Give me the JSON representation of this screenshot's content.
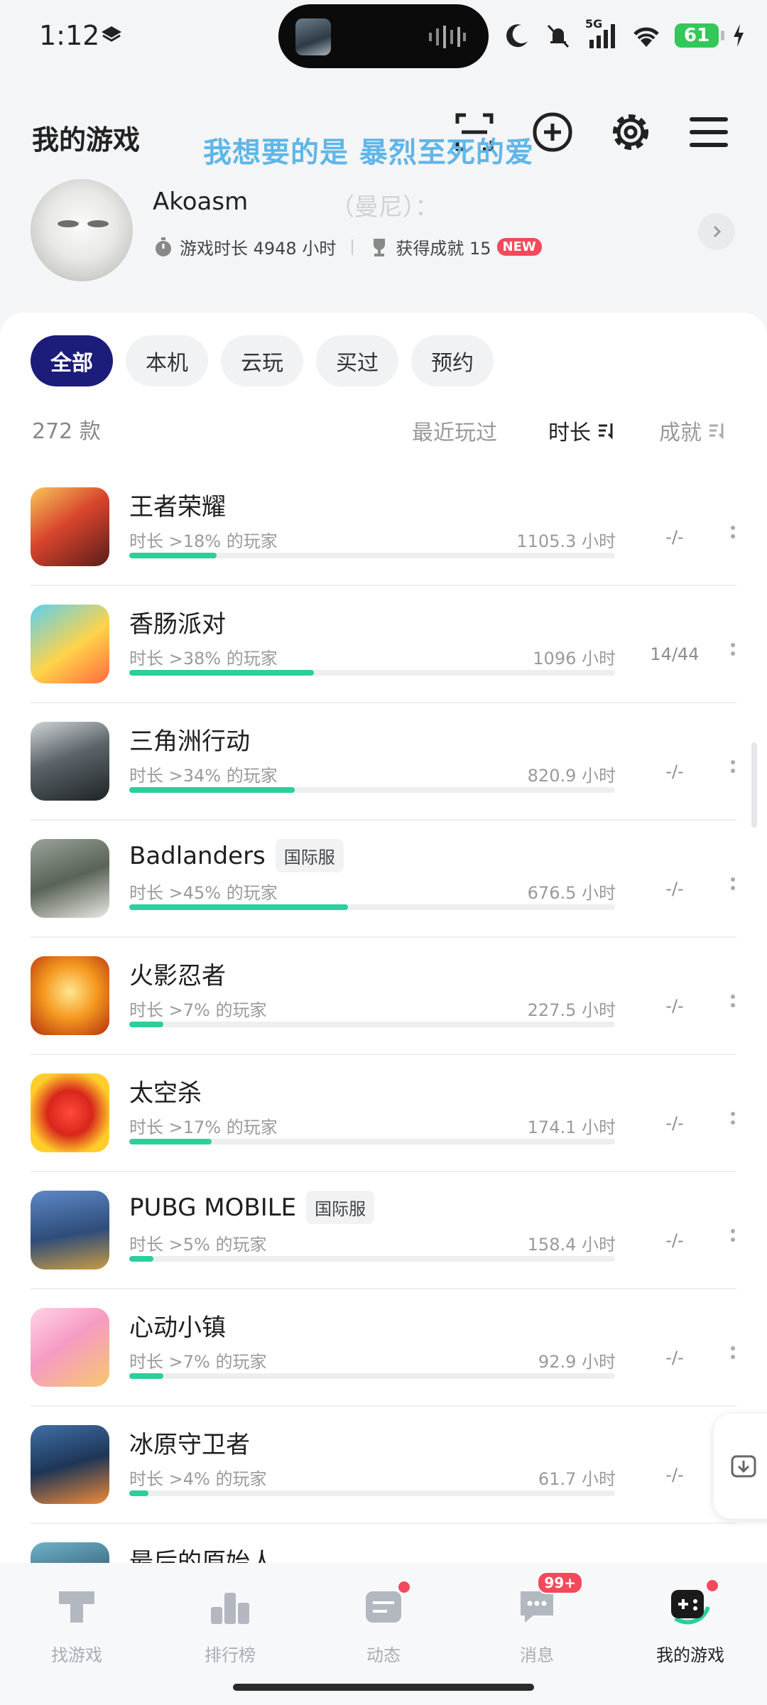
{
  "status_bar": {
    "time": "1:12",
    "battery": "61",
    "network": "5G"
  },
  "header": {
    "title": "我的游戏",
    "lyric_overlay": "我想要的是 暴烈至死的爱",
    "lyric_overlay_2": "（曼尼）：",
    "icons": [
      "scan-icon",
      "add-icon",
      "settings-icon",
      "menu-icon"
    ]
  },
  "profile": {
    "username": "Akoasm",
    "playtime": "游戏时长 4948 小时",
    "achievements": "获得成就 15",
    "new_badge": "NEW"
  },
  "filter_tabs": [
    "全部",
    "本机",
    "云玩",
    "买过",
    "预约"
  ],
  "game_count": "272 款",
  "sort_options": {
    "recent": "最近玩过",
    "duration": "时长",
    "achievement": "成就"
  },
  "colors": {
    "accent": "#1c1c7a",
    "progress": "#2ccf9c",
    "badge": "#f24a5a"
  },
  "games": [
    {
      "name": "王者荣耀",
      "tag": "",
      "percentile": "时长 >18% 的玩家",
      "hours": "1105.3 小时",
      "achievement": "-/-",
      "progress": 0.18
    },
    {
      "name": "香肠派对",
      "tag": "",
      "percentile": "时长 >38% 的玩家",
      "hours": "1096 小时",
      "achievement": "14/44",
      "progress": 0.38
    },
    {
      "name": "三角洲行动",
      "tag": "",
      "percentile": "时长 >34% 的玩家",
      "hours": "820.9 小时",
      "achievement": "-/-",
      "progress": 0.34
    },
    {
      "name": "Badlanders",
      "tag": "国际服",
      "percentile": "时长 >45% 的玩家",
      "hours": "676.5 小时",
      "achievement": "-/-",
      "progress": 0.45
    },
    {
      "name": "火影忍者",
      "tag": "",
      "percentile": "时长 >7% 的玩家",
      "hours": "227.5 小时",
      "achievement": "-/-",
      "progress": 0.07
    },
    {
      "name": "太空杀",
      "tag": "",
      "percentile": "时长 >17% 的玩家",
      "hours": "174.1 小时",
      "achievement": "-/-",
      "progress": 0.17
    },
    {
      "name": "PUBG MOBILE",
      "tag": "国际服",
      "percentile": "时长 >5% 的玩家",
      "hours": "158.4 小时",
      "achievement": "-/-",
      "progress": 0.05
    },
    {
      "name": "心动小镇",
      "tag": "",
      "percentile": "时长 >7% 的玩家",
      "hours": "92.9 小时",
      "achievement": "-/-",
      "progress": 0.07
    },
    {
      "name": "冰原守卫者",
      "tag": "",
      "percentile": "时长 >4% 的玩家",
      "hours": "61.7 小时",
      "achievement": "-/-",
      "progress": 0.04
    },
    {
      "name": "最后的原始人",
      "tag": "",
      "percentile": "",
      "hours": "",
      "achievement": "",
      "progress": 0
    }
  ],
  "bottom_nav": [
    {
      "label": "找游戏",
      "icon": "find-games-icon"
    },
    {
      "label": "排行榜",
      "icon": "leaderboard-icon"
    },
    {
      "label": "动态",
      "icon": "feed-icon"
    },
    {
      "label": "消息",
      "icon": "message-icon",
      "badge": "99+"
    },
    {
      "label": "我的游戏",
      "icon": "my-games-icon"
    }
  ]
}
